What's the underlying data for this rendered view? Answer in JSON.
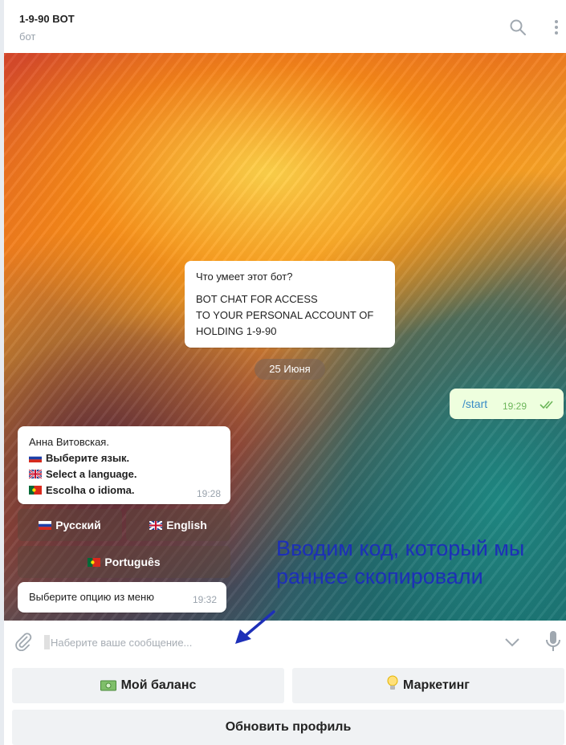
{
  "header": {
    "title": "1-9-90 BOT",
    "subtitle": "бот",
    "icons": [
      "search-icon",
      "more-vertical-icon"
    ]
  },
  "chat": {
    "bot_info": {
      "question": "Что умеет этот бот?",
      "answer_lines": [
        "BOT CHAT FOR ACCESS",
        "TO YOUR PERSONAL ACCOUNT OF",
        "HOLDING 1-9-90"
      ]
    },
    "date_separator": "25 Июня",
    "outgoing": {
      "text": "/start",
      "time": "19:29",
      "status": "read-double-check"
    },
    "language_message": {
      "sender": "Анна Витовская.",
      "lines": [
        "Выберите язык.",
        "Select a language.",
        "Escolha o idioma."
      ],
      "time": "19:28"
    },
    "inline_keyboard": [
      {
        "label": "Русский",
        "flag": "ru"
      },
      {
        "label": "English",
        "flag": "gb"
      },
      {
        "label": "Português",
        "flag": "pt"
      }
    ],
    "menu_message": {
      "text": "Выберите опцию из меню",
      "time": "19:32"
    }
  },
  "annotation": {
    "line1": "Вводим код, который мы",
    "line2": "раннее скопировали",
    "color": "#1d2fb8"
  },
  "input": {
    "placeholder": "Наберите ваше сообщение...",
    "value": ""
  },
  "reply_keyboard": {
    "balance": "Мой баланс",
    "marketing": "Маркетинг",
    "update_profile": "Обновить профиль"
  },
  "colors": {
    "accent": "#3a8bc6",
    "outgoing_bg": "#eeffde",
    "read_check": "#6cb65a"
  }
}
